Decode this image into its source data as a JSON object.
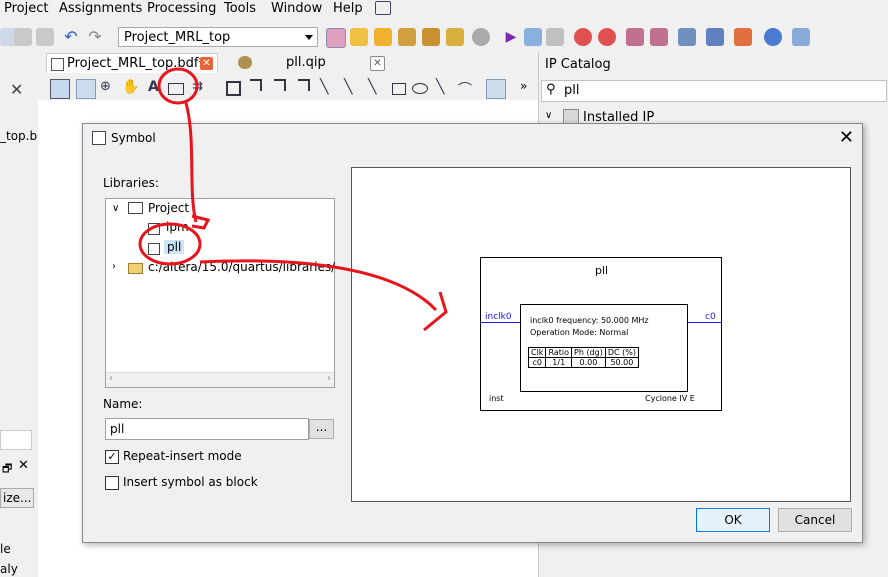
{
  "menu": [
    "Project",
    "Assignments",
    "Processing",
    "Tools",
    "Window",
    "Help"
  ],
  "toolbar": {
    "project_select": "Project_MRL_top"
  },
  "tabs": [
    {
      "label": "Project_MRL_top.bdf*"
    },
    {
      "label": "pll.qip"
    }
  ],
  "ip_catalog": {
    "title": "IP Catalog",
    "search_value": "pll",
    "tree_root": "Installed IP"
  },
  "left_pane": {
    "partial_a": "_top.b",
    "partial_b": "ize...",
    "partial_c": "le",
    "partial_d": "aly"
  },
  "dialog": {
    "title": "Symbol",
    "libraries_label": "Libraries:",
    "tree": {
      "root": "Project",
      "child1": "lpm",
      "child2": "pll",
      "path": "c:/altera/15.0/quartus/libraries/"
    },
    "name_label": "Name:",
    "name_value": "pll",
    "browse_label": "...",
    "repeat_insert": {
      "label": "Repeat-insert mode",
      "checked": true
    },
    "insert_block": {
      "label": "Insert symbol as block",
      "checked": false
    },
    "ok": "OK",
    "cancel": "Cancel"
  },
  "symbol": {
    "name": "pll",
    "input_port": "inclk0",
    "output_port": "c0",
    "freq_text": "inclk0 frequency: 50.000 MHz",
    "mode_text": "Operation Mode: Normal",
    "table_headers": [
      "Clk",
      "Ratio",
      "Ph (dg)",
      "DC (%)"
    ],
    "table_row": [
      "c0",
      "1/1",
      "0.00",
      "50.00"
    ],
    "instance": "inst",
    "device": "Cyclone IV E"
  },
  "colors": {
    "annotation": "#e8141c",
    "port_blue": "#1a1aff",
    "ok_border": "#0078d7"
  }
}
